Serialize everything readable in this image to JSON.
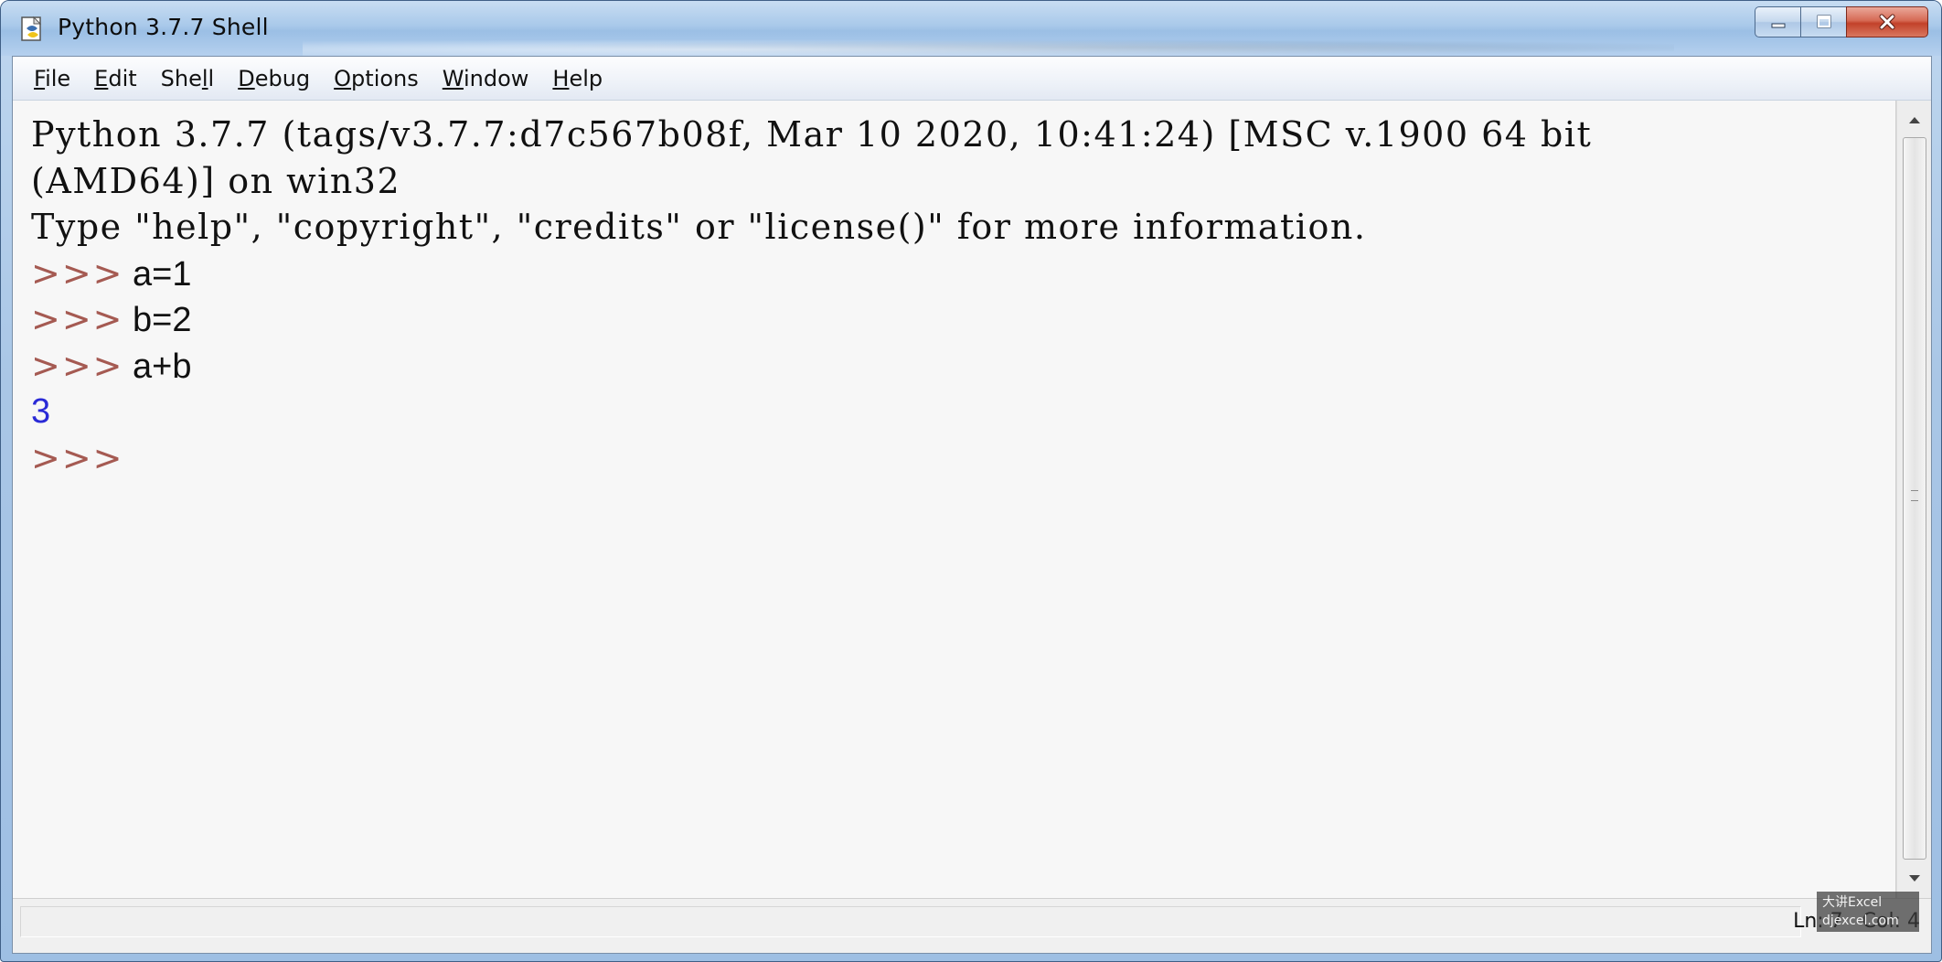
{
  "window": {
    "title": "Python 3.7.7 Shell"
  },
  "menu": [
    {
      "pre": "",
      "mnem": "F",
      "post": "ile"
    },
    {
      "pre": "",
      "mnem": "E",
      "post": "dit"
    },
    {
      "pre": "She",
      "mnem": "l",
      "post": "l"
    },
    {
      "pre": "",
      "mnem": "D",
      "post": "ebug"
    },
    {
      "pre": "",
      "mnem": "O",
      "post": "ptions"
    },
    {
      "pre": "",
      "mnem": "W",
      "post": "indow"
    },
    {
      "pre": "",
      "mnem": "H",
      "post": "elp"
    }
  ],
  "shell": {
    "banner_line1": "Python 3.7.7 (tags/v3.7.7:d7c567b08f, Mar 10 2020, 10:41:24) [MSC v.1900 64 bit",
    "banner_line2": "(AMD64)] on win32",
    "banner_line3": "Type \"help\", \"copyright\", \"credits\" or \"license()\" for more information.",
    "prompt": ">>>",
    "inputs": [
      "a=1",
      "b=2",
      "a+b"
    ],
    "output": "3"
  },
  "status": {
    "position": "Ln: 7   Col: 4"
  },
  "watermark": {
    "line1": "大讲Excel",
    "line2": "djexcel.com"
  },
  "colors": {
    "prompt": "#a55a52",
    "output": "#2a2ad6",
    "editor_bg": "#f7f7f7"
  }
}
